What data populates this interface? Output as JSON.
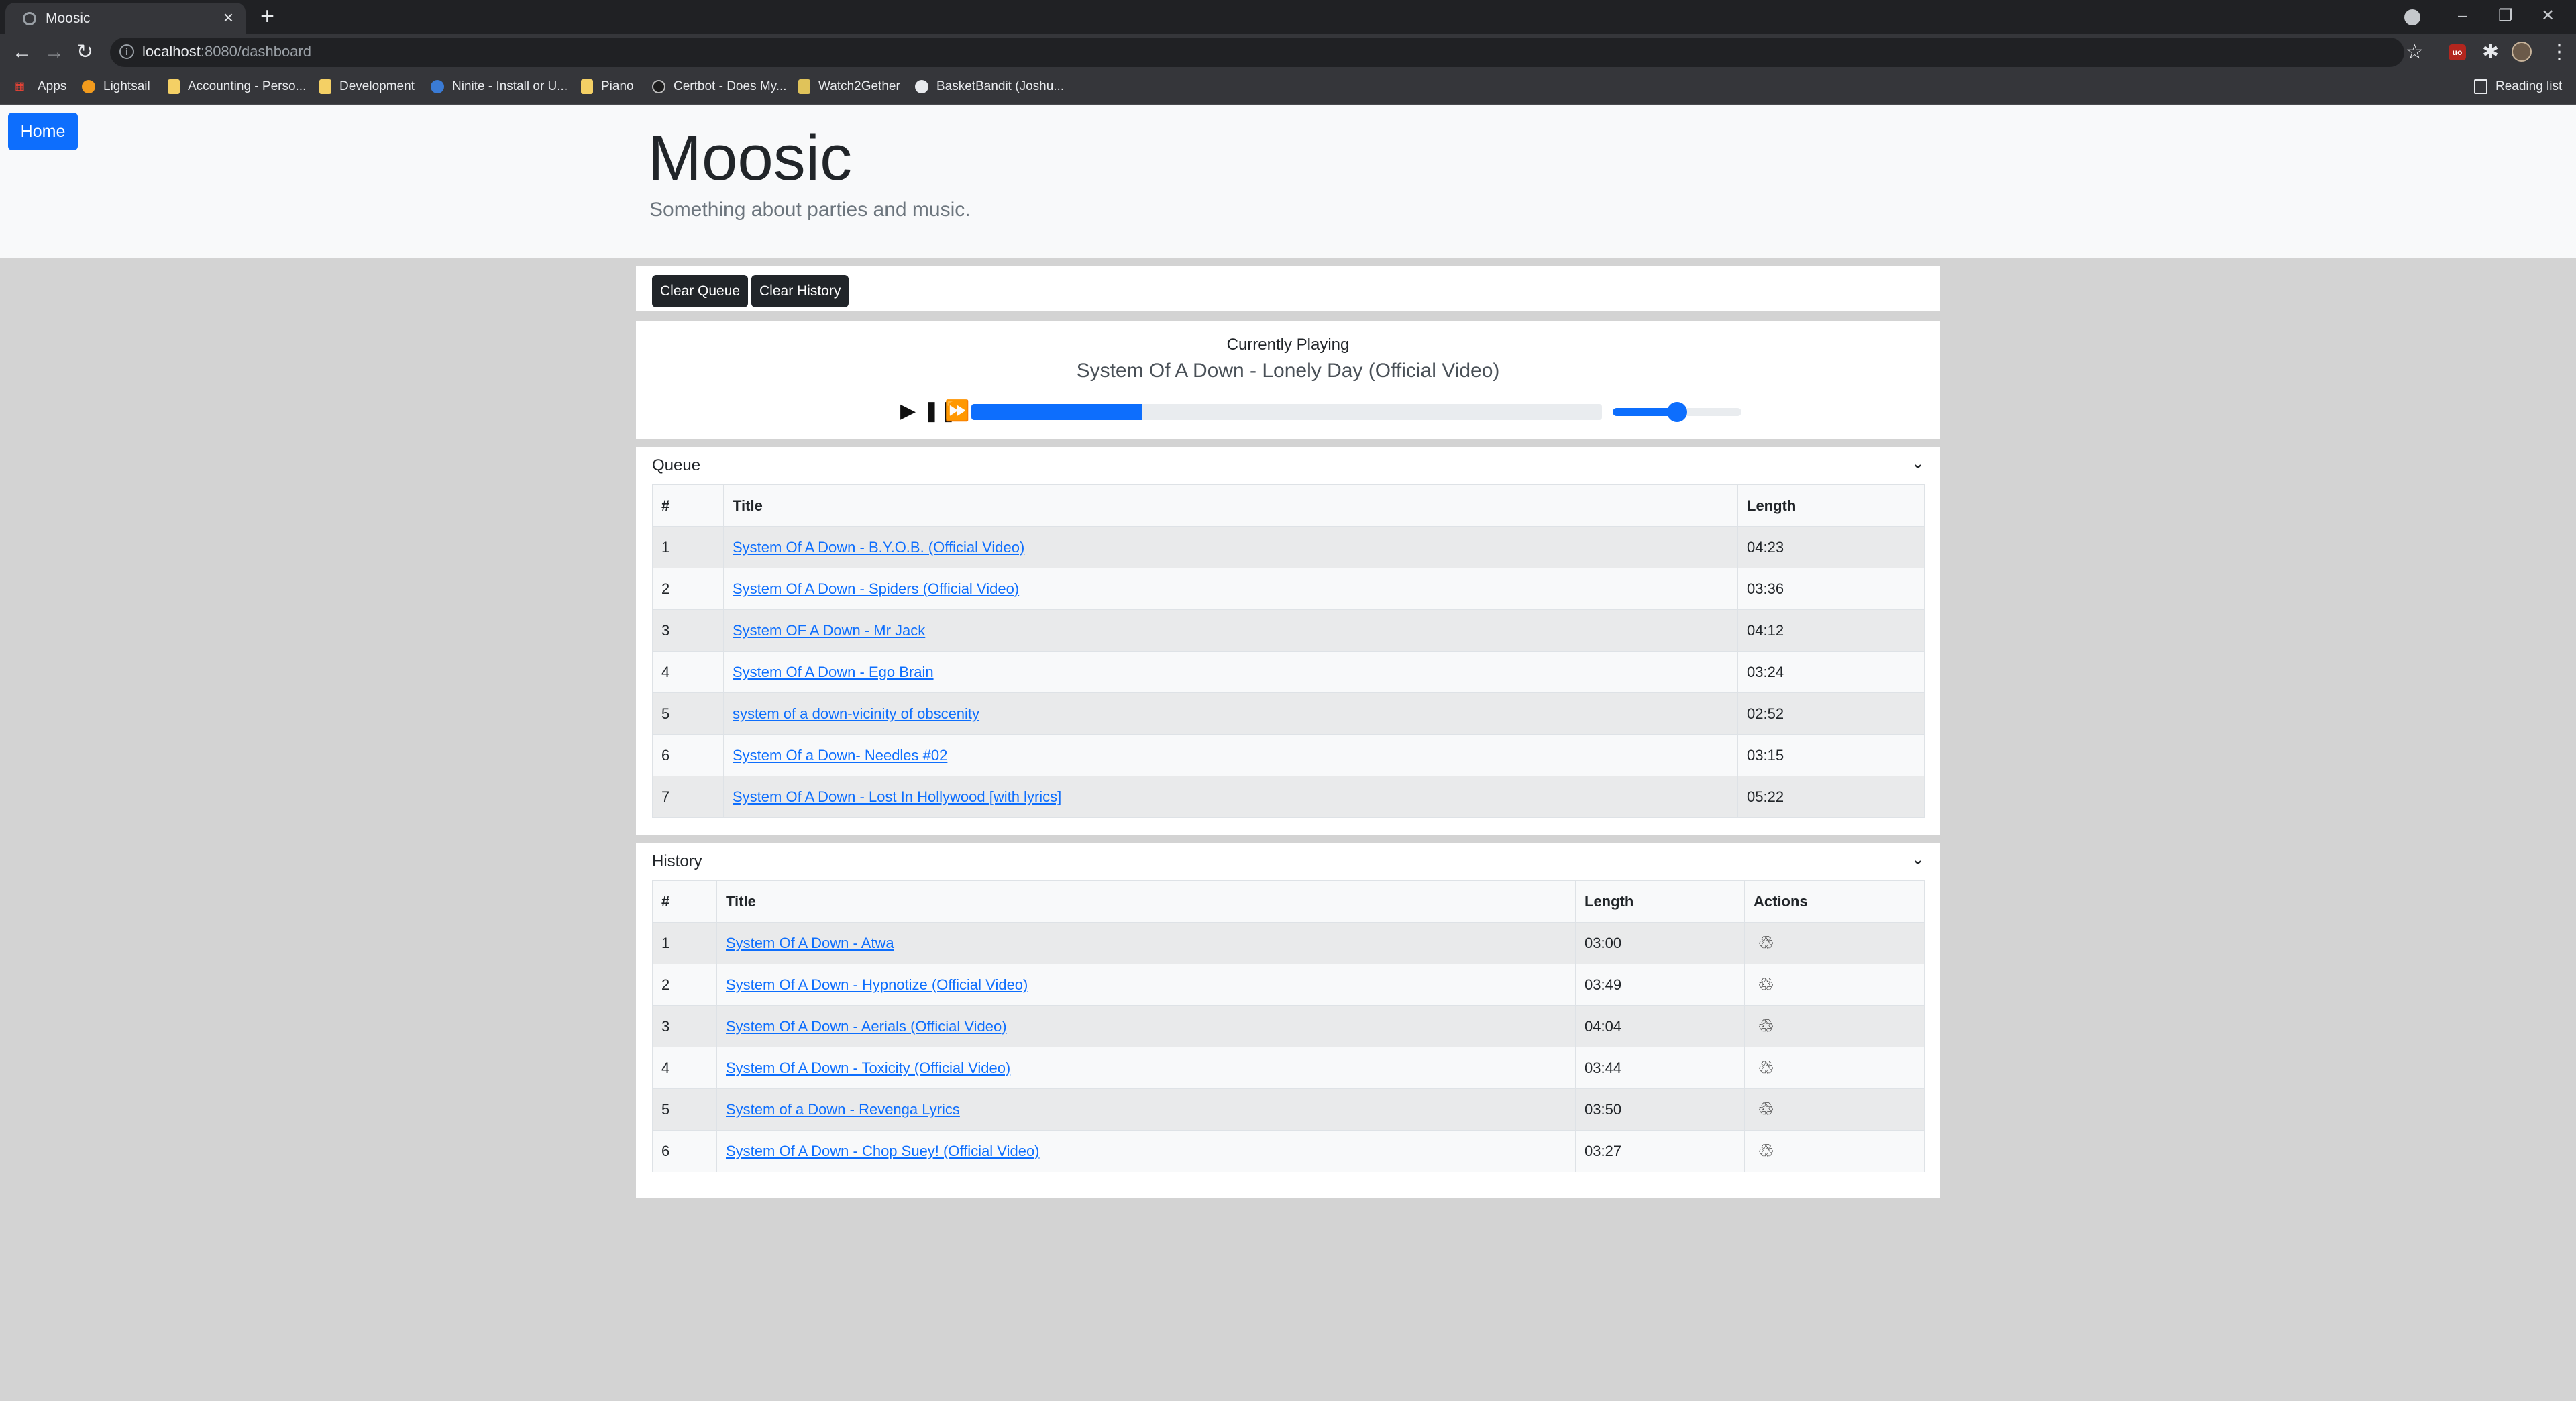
{
  "browser": {
    "tab_title": "Moosic",
    "tab_close": "×",
    "new_tab": "+",
    "url_host": "localhost",
    "url_path": ":8080/dashboard",
    "bookmarks": [
      {
        "label": "Apps",
        "icon": "apps-grid-icon"
      },
      {
        "label": "Lightsail",
        "icon": "lightsail-icon"
      },
      {
        "label": "Accounting - Perso...",
        "icon": "folder-icon"
      },
      {
        "label": "Development",
        "icon": "folder-icon"
      },
      {
        "label": "Ninite - Install or U...",
        "icon": "ninite-icon"
      },
      {
        "label": "Piano",
        "icon": "folder-icon"
      },
      {
        "label": "Certbot - Does My...",
        "icon": "certbot-icon"
      },
      {
        "label": "Watch2Gether",
        "icon": "watch2gether-icon"
      },
      {
        "label": "BasketBandit (Joshu...",
        "icon": "github-icon"
      }
    ],
    "reading_list": "Reading list"
  },
  "nav": {
    "home_label": "Home"
  },
  "header": {
    "title": "Moosic",
    "subtitle": "Something about parties and music."
  },
  "actions": {
    "clear_queue": "Clear Queue",
    "clear_history": "Clear History"
  },
  "player": {
    "label": "Currently Playing",
    "song": "System Of A Down - Lonely Day (Official Video)",
    "progress_fraction": 0.27,
    "volume_fraction": 0.5,
    "colors": {
      "accent": "#0d6efd"
    }
  },
  "queue": {
    "label": "Queue",
    "headers": {
      "num": "#",
      "title": "Title",
      "length": "Length"
    },
    "rows": [
      {
        "num": "1",
        "title": "System Of A Down - B.Y.O.B. (Official Video)",
        "length": "04:23"
      },
      {
        "num": "2",
        "title": "System Of A Down - Spiders (Official Video)",
        "length": "03:36"
      },
      {
        "num": "3",
        "title": "System OF A Down - Mr Jack",
        "length": "04:12"
      },
      {
        "num": "4",
        "title": "System Of A Down - Ego Brain",
        "length": "03:24"
      },
      {
        "num": "5",
        "title": "system of a down-vicinity of obscenity",
        "length": "02:52"
      },
      {
        "num": "6",
        "title": "System Of a Down- Needles #02",
        "length": "03:15"
      },
      {
        "num": "7",
        "title": "System Of A Down - Lost In Hollywood [with lyrics]",
        "length": "05:22"
      }
    ]
  },
  "history": {
    "label": "History",
    "headers": {
      "num": "#",
      "title": "Title",
      "length": "Length",
      "actions": "Actions"
    },
    "requeue_icon": "recycle-icon",
    "rows": [
      {
        "num": "1",
        "title": "System Of A Down - Atwa",
        "length": "03:00"
      },
      {
        "num": "2",
        "title": "System Of A Down - Hypnotize (Official Video)",
        "length": "03:49"
      },
      {
        "num": "3",
        "title": "System Of A Down - Aerials (Official Video)",
        "length": "04:04"
      },
      {
        "num": "4",
        "title": "System Of A Down - Toxicity (Official Video)",
        "length": "03:44"
      },
      {
        "num": "5",
        "title": "System of a Down - Revenga Lyrics",
        "length": "03:50"
      },
      {
        "num": "6",
        "title": "System Of A Down - Chop Suey! (Official Video)",
        "length": "03:27"
      }
    ]
  }
}
